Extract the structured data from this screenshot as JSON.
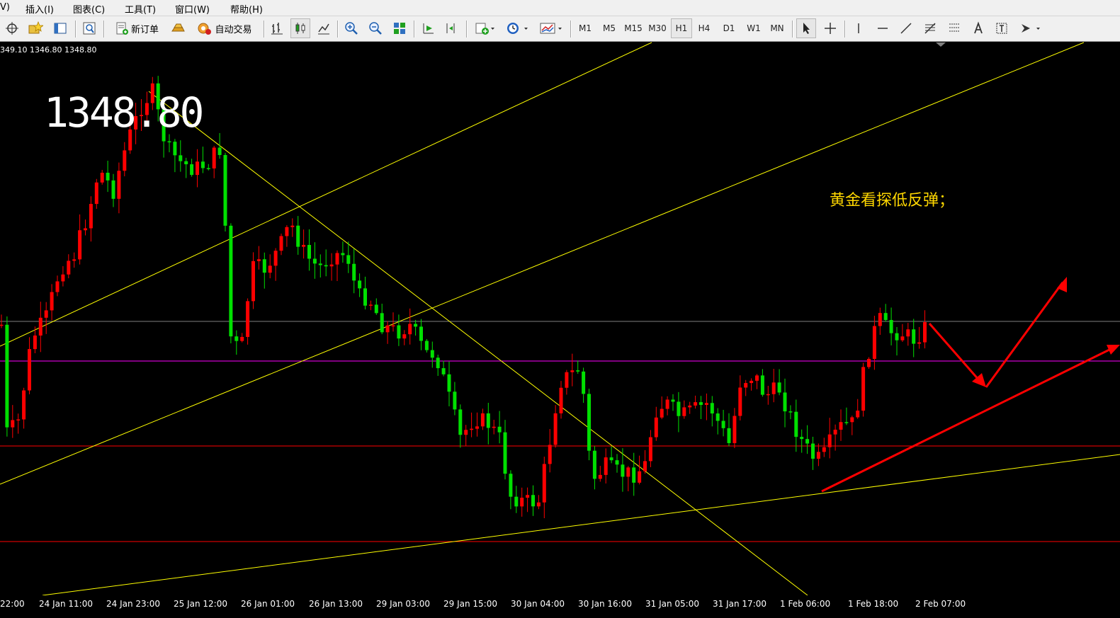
{
  "menu": [
    "V)",
    "插入(I)",
    "图表(C)",
    "工具(T)",
    "窗口(W)",
    "帮助(H)"
  ],
  "toolbar": {
    "new_order": "新订单",
    "auto_trading": "自动交易",
    "timeframes": [
      "M1",
      "M5",
      "M15",
      "M30",
      "H1",
      "H4",
      "D1",
      "W1",
      "MN"
    ],
    "active_timeframe": "H1",
    "icons": [
      "crosshair-target-icon",
      "favorites-icon",
      "navigator-icon",
      "zoom-chart-icon",
      "new-order-icon",
      "gold-bar-icon",
      "auto-trading-icon",
      "bar-chart-icon",
      "candlestick-icon",
      "line-chart-icon",
      "zoom-in-icon",
      "zoom-out-icon",
      "tile-windows-icon",
      "autoscroll-icon",
      "chart-shift-icon",
      "indicators-icon",
      "periods-icon",
      "templates-icon",
      "cursor-icon",
      "crosshair-icon",
      "vertical-line-icon",
      "horizontal-line-icon",
      "trendline-icon",
      "fibonacci-icon",
      "channel-icon",
      "text-icon",
      "text-label-icon",
      "arrows-icon"
    ]
  },
  "chart": {
    "ohlc_text": "349.10 1346.80 1348.80",
    "big_price": "1348.80",
    "annotation": "黄金看探低反弹；",
    "colors": {
      "background": "#000000",
      "bull": "#ff0000",
      "bear": "#00e000",
      "trendline": "#ffff00",
      "hline_gray": "#808080",
      "hline_magenta": "#ff00ff",
      "hline_red": "#ff0000",
      "arrow": "#ff0000"
    },
    "time_labels": [
      "22:00",
      "24 Jan 11:00",
      "24 Jan 23:00",
      "25 Jan 12:00",
      "26 Jan 01:00",
      "26 Jan 13:00",
      "29 Jan 03:00",
      "29 Jan 15:00",
      "30 Jan 04:00",
      "30 Jan 16:00",
      "31 Jan 05:00",
      "31 Jan 17:00",
      "1 Feb 06:00",
      "1 Feb 18:00",
      "2 Feb 07:00"
    ]
  }
}
